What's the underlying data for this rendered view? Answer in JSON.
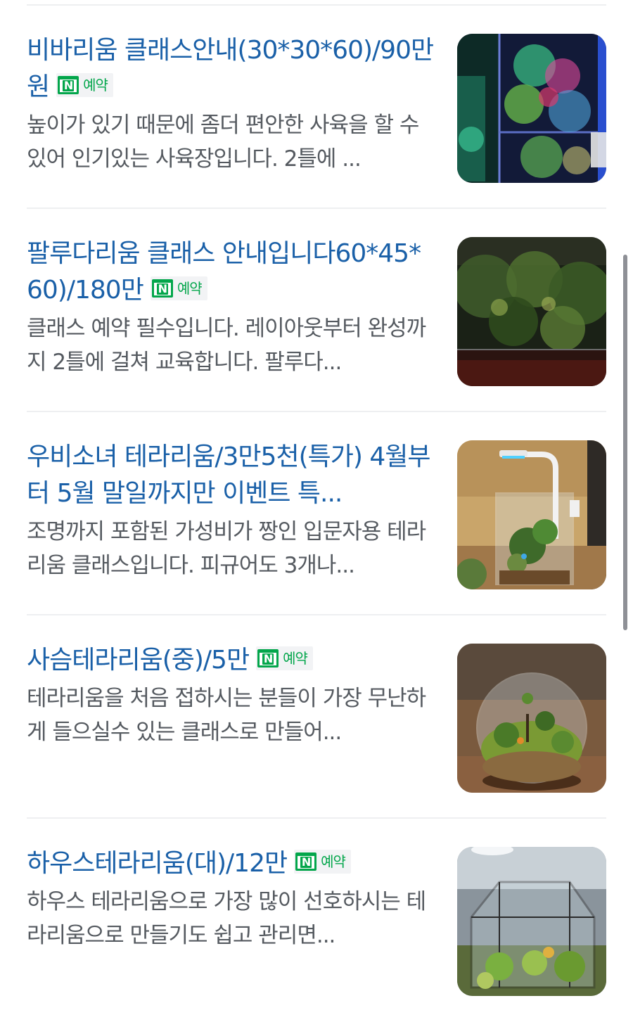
{
  "results": [
    {
      "title": "비바리움 클래스안내(30*30*60)/90만원",
      "badge": "예약",
      "badge_icon": "naver-reservation-icon",
      "description": "높이가 있기 때문에 좀더 편안한 사육을 할 수있어 인기있는 사육장입니다. 2틀에 ...",
      "thumbnail": "vivarium-tank-photo"
    },
    {
      "title": "팔루다리움 클래스 안내입니다60*45*60)/180만",
      "badge": "예약",
      "badge_icon": "naver-reservation-icon",
      "description": "클래스 예약 필수입니다. 레이아웃부터 완성까지 2틀에 걸쳐 교육합니다. 팔루다...",
      "thumbnail": "paludarium-tank-photo"
    },
    {
      "title": "우비소녀 테라리움/3만5천(특가) 4월부터 5월 말일까지만 이벤트 특...",
      "badge": "",
      "badge_icon": "",
      "description": "조명까지 포함된 가성비가 짱인 입문자용 테라리움 클래스입니다. 피규어도 3개나...",
      "thumbnail": "rain-girl-terrarium-photo"
    },
    {
      "title": "사슴테라리움(중)/5만",
      "badge": "예약",
      "badge_icon": "naver-reservation-icon",
      "description": "테라리움을 처음 접하시는 분들이 가장 무난하게 들으실수 있는 클래스로 만들어...",
      "thumbnail": "deer-terrarium-bowl-photo"
    },
    {
      "title": "하우스테라리움(대)/12만",
      "badge": "예약",
      "badge_icon": "naver-reservation-icon",
      "description": "하우스 테라리움으로 가장 많이 선호하시는 테라리움으로 만들기도 쉽고 관리면...",
      "thumbnail": "house-terrarium-photo"
    }
  ],
  "colors": {
    "title": "#1a60a8",
    "description": "#555a60",
    "badge_green": "#03a64b",
    "divider": "#eeeff1"
  }
}
